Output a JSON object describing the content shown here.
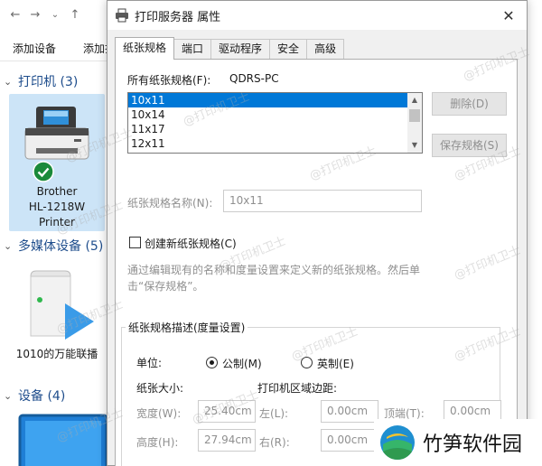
{
  "explorer": {
    "toolbar": {
      "add_device": "添加设备",
      "add_printer": "添加打"
    },
    "groups": [
      {
        "label": "打印机 (3)"
      },
      {
        "label": "多媒体设备 (5)"
      },
      {
        "label": "设备 (4)"
      }
    ],
    "printer_tile": {
      "line1": "Brother",
      "line2": "HL-1218W",
      "line3": "Printer"
    },
    "media_tile": {
      "label": "1010的万能联播"
    }
  },
  "dialog": {
    "title": "打印服务器 属性",
    "tabs": [
      "纸张规格",
      "端口",
      "驱动程序",
      "安全",
      "高级"
    ],
    "all_forms_label": "所有纸张规格(F):",
    "server_name": "QDRS-PC",
    "forms": [
      "10x11",
      "10x14",
      "11x17",
      "12x11"
    ],
    "selected_form": "10x11",
    "delete_button": "删除(D)",
    "save_form_button": "保存规格(S)",
    "form_name_label": "纸张规格名称(N):",
    "form_name_value": "10x11",
    "create_new_label": "创建新纸张规格(C)",
    "description": "通过编辑现有的名称和度量设置来定义新的纸张规格。然后单击“保存规格”。",
    "group_title": "纸张规格描述(度量设置)",
    "units_label": "单位:",
    "metric_label": "公制(M)",
    "english_label": "英制(E)",
    "paper_size_label": "纸张大小:",
    "printer_area_label": "打印机区域边距:",
    "width_label": "宽度(W):",
    "width_value": "25.40cm",
    "height_label": "高度(H):",
    "height_value": "27.94cm",
    "left_label": "左(L):",
    "left_value": "0.00cm",
    "right_label": "右(R):",
    "right_value": "0.00cm",
    "top_label": "顶端(T):",
    "top_value": "0.00cm"
  },
  "watermark": "@打印机卫士",
  "brand": "竹笋软件园"
}
